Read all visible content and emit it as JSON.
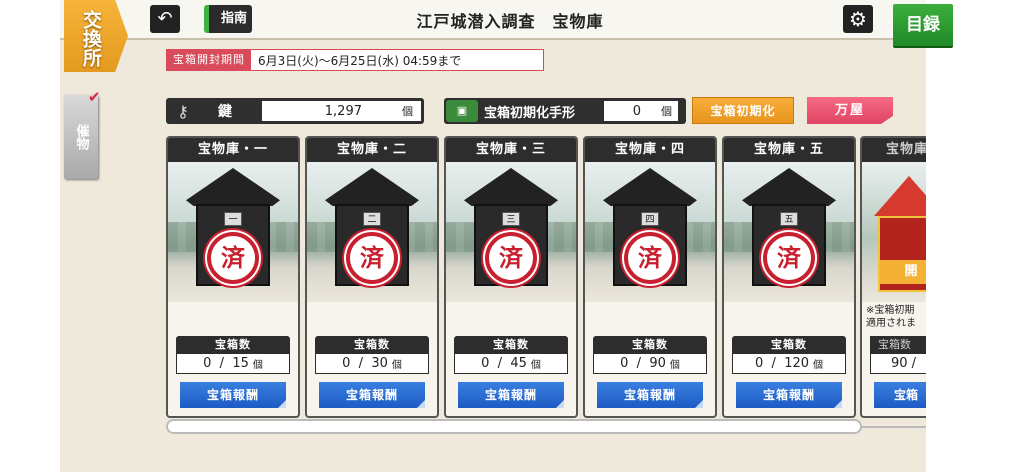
{
  "header": {
    "exchange_tab": "交換所",
    "back_icon": "back-arrow-icon",
    "guide_label": "指南",
    "title": "江戸城潜入調査　宝物庫",
    "settings_icon": "gear-icon",
    "catalog_label": "目録"
  },
  "period": {
    "label": "宝箱開封期間",
    "value": "6月3日(火)～6月25日(水) 04:59まで"
  },
  "side_tab": {
    "label": "催物"
  },
  "resources": {
    "key_label": "鍵",
    "key_value": "1,297",
    "key_unit": "個",
    "reset_ticket_label": "宝箱初期化手形",
    "reset_ticket_value": "0",
    "reset_ticket_unit": "個"
  },
  "buttons": {
    "reset_label": "宝箱初期化",
    "shop_label": "万屋"
  },
  "vaults": [
    {
      "title": "宝物庫・一",
      "plaque": "一",
      "stamp": "済",
      "count_label": "宝箱数",
      "opened": "0",
      "sep": "/",
      "total": "15",
      "unit": "個",
      "reward_label": "宝箱報酬"
    },
    {
      "title": "宝物庫・二",
      "plaque": "二",
      "stamp": "済",
      "count_label": "宝箱数",
      "opened": "0",
      "sep": "/",
      "total": "30",
      "unit": "個",
      "reward_label": "宝箱報酬"
    },
    {
      "title": "宝物庫・三",
      "plaque": "三",
      "stamp": "済",
      "count_label": "宝箱数",
      "opened": "0",
      "sep": "/",
      "total": "45",
      "unit": "個",
      "reward_label": "宝箱報酬"
    },
    {
      "title": "宝物庫・四",
      "plaque": "四",
      "stamp": "済",
      "count_label": "宝箱数",
      "opened": "0",
      "sep": "/",
      "total": "90",
      "unit": "個",
      "reward_label": "宝箱報酬"
    },
    {
      "title": "宝物庫・五",
      "plaque": "五",
      "stamp": "済",
      "count_label": "宝箱数",
      "opened": "0",
      "sep": "/",
      "total": "120",
      "unit": "個",
      "reward_label": "宝箱報酬"
    }
  ],
  "vault6_partial": {
    "title": "宝物庫",
    "open_label": "開",
    "note_line1": "※宝箱初期",
    "note_line2": "適用されま",
    "count_label": "宝箱数",
    "count_value": "90 /",
    "reward_label": "宝箱"
  }
}
